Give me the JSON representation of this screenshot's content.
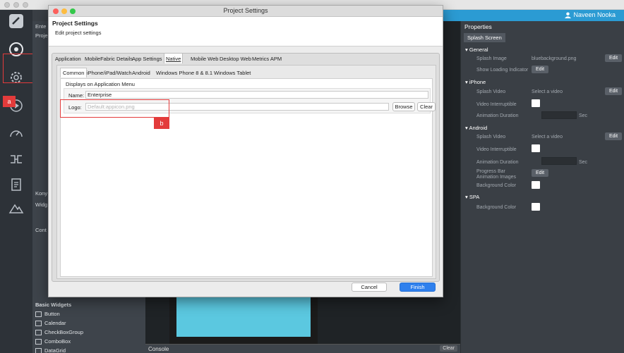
{
  "user": {
    "name": "Naveen Nooka"
  },
  "explorer": {
    "header_labels": [
      "Ente",
      "Proje"
    ],
    "section_labels": [
      "Kony",
      "Widg",
      "Cont"
    ],
    "basic_widgets_title": "Basic Widgets",
    "widgets": [
      "Button",
      "Calendar",
      "CheckBoxGroup",
      "ComboBox",
      "DataGrid"
    ]
  },
  "annotations": {
    "a": "a",
    "b": "b"
  },
  "console": {
    "title": "Console",
    "clear_label": "Clear"
  },
  "properties": {
    "title": "Properties",
    "tab": "Splash Screen",
    "edit_label": "Edit",
    "sections": {
      "general": {
        "title": "General",
        "splash_image_label": "Splash Image",
        "splash_image_value": "bluebackground.png",
        "show_loading_label": "Show Loading Indicator"
      },
      "iphone": {
        "title": "iPhone",
        "splash_video_label": "Splash Video",
        "splash_video_value": "Select a video",
        "video_interruptible_label": "Video Interruptible",
        "animation_duration_label": "Animation Duration",
        "unit": "Sec"
      },
      "android": {
        "title": "Android",
        "splash_video_label": "Splash Video",
        "splash_video_value": "Select a video",
        "video_interruptible_label": "Video Interruptible",
        "animation_duration_label": "Animation Duration",
        "unit": "Sec",
        "progress_label": "Progress Bar Animation Images",
        "background_color_label": "Background Color"
      },
      "spa": {
        "title": "SPA",
        "background_color_label": "Background Color"
      }
    }
  },
  "dialog": {
    "window_title": "Project Settings",
    "heading": "Project Settings",
    "subheading": "Edit project settings",
    "tabs": [
      "Application",
      "MobileFabric Details",
      "App Settings",
      "Native",
      "Mobile Web",
      "Desktop Web",
      "Metrics APM"
    ],
    "subtabs": [
      "Common",
      "iPhone/iPad/Watch",
      "Android",
      "Windows Phone 8 & 8.1",
      "Windows Tablet"
    ],
    "group_title": "Displays on Application Menu",
    "name_label": "Name:",
    "name_value": "Enterprise",
    "logo_label": "Logo:",
    "logo_placeholder": "Default:appicon.png",
    "browse_label": "Browse",
    "clear_label": "Clear",
    "cancel_label": "Cancel",
    "finish_label": "Finish"
  }
}
